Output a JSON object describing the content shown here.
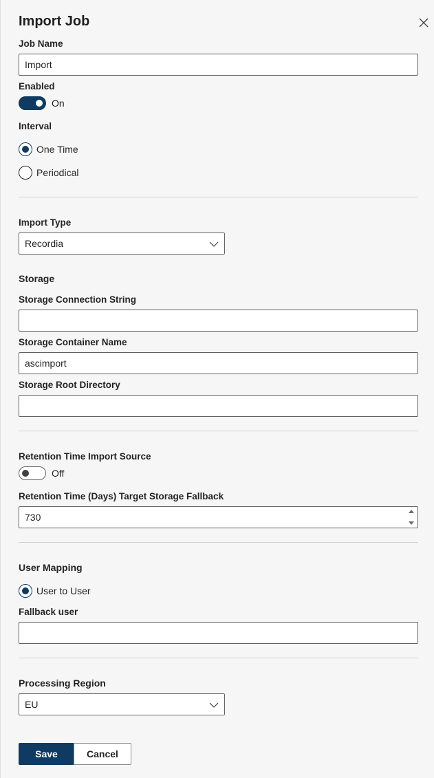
{
  "dialog": {
    "title": "Import Job"
  },
  "job_name": {
    "label": "Job Name",
    "value": "Import"
  },
  "enabled": {
    "label": "Enabled",
    "state_text": "On",
    "checked": true
  },
  "interval": {
    "label": "Interval",
    "options": [
      {
        "label": "One Time",
        "checked": true
      },
      {
        "label": "Periodical",
        "checked": false
      }
    ]
  },
  "import_type": {
    "label": "Import Type",
    "selected": "Recordia"
  },
  "storage": {
    "heading": "Storage",
    "connection_string": {
      "label": "Storage Connection String",
      "value": ""
    },
    "container_name": {
      "label": "Storage Container Name",
      "value": "ascimport"
    },
    "root_directory": {
      "label": "Storage Root Directory",
      "value": ""
    }
  },
  "retention_source": {
    "label": "Retention Time Import Source",
    "state_text": "Off",
    "checked": false
  },
  "retention_fallback": {
    "label": "Retention Time (Days) Target Storage Fallback",
    "value": "730"
  },
  "user_mapping": {
    "label": "User Mapping",
    "options": [
      {
        "label": "User to User",
        "checked": true
      }
    ],
    "fallback_user": {
      "label": "Fallback user",
      "value": ""
    }
  },
  "processing_region": {
    "label": "Processing Region",
    "selected": "EU"
  },
  "actions": {
    "save": "Save",
    "cancel": "Cancel"
  },
  "colors": {
    "accent": "#0f3a62",
    "background": "#f6f6f6",
    "border": "#616161"
  }
}
